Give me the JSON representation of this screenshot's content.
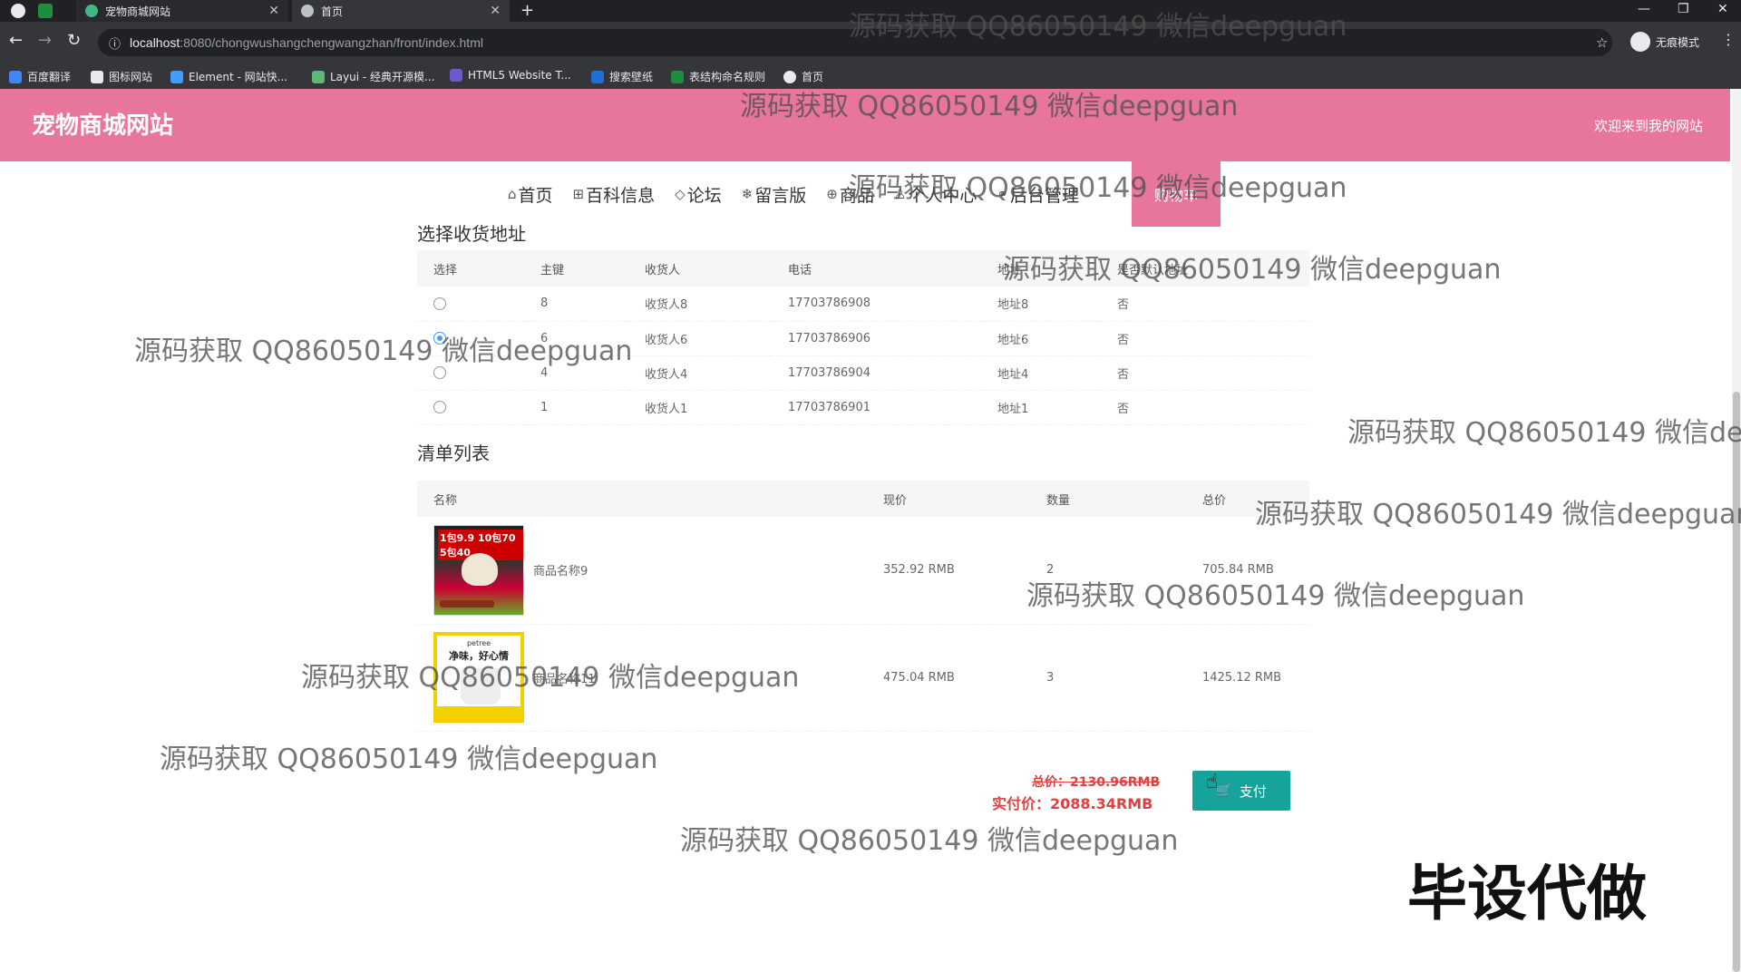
{
  "browser": {
    "tabs": [
      {
        "label": "宠物商城网站"
      },
      {
        "label": "首页"
      }
    ],
    "address": {
      "host": "localhost",
      "path": ":8080/chongwushangchengwangzhan/front/index.html"
    },
    "incognito_label": "无痕模式",
    "bookmarks": [
      "百度翻译",
      "图标网站",
      "Element - 网站快...",
      "Layui - 经典开源模...",
      "HTML5 Website T...",
      "搜索壁纸",
      "表结构命名规则",
      "首页"
    ]
  },
  "site": {
    "title": "宠物商城网站",
    "welcome": "欢迎来到我的网站",
    "accent_color": "#e8769a"
  },
  "nav": {
    "items": [
      {
        "label": "首页",
        "icon": "home-icon"
      },
      {
        "label": "百科信息",
        "icon": "grid-icon"
      },
      {
        "label": "论坛",
        "icon": "tag-icon"
      },
      {
        "label": "留言版",
        "icon": "snowflake-icon"
      },
      {
        "label": "商品",
        "icon": "cart-icon"
      },
      {
        "label": "个人中心",
        "icon": "user-icon"
      },
      {
        "label": "后台管理",
        "icon": "link-icon"
      }
    ],
    "cart_label": "购物车"
  },
  "address_section": {
    "title": "选择收货地址",
    "headers": [
      "选择",
      "主键",
      "收货人",
      "电话",
      "地址",
      "是否默认地址"
    ],
    "rows": [
      {
        "selected": false,
        "id": "8",
        "name": "收货人8",
        "phone": "17703786908",
        "address": "地址8",
        "default": "否"
      },
      {
        "selected": true,
        "id": "6",
        "name": "收货人6",
        "phone": "17703786906",
        "address": "地址6",
        "default": "否"
      },
      {
        "selected": false,
        "id": "4",
        "name": "收货人4",
        "phone": "17703786904",
        "address": "地址4",
        "default": "否"
      },
      {
        "selected": false,
        "id": "1",
        "name": "收货人1",
        "phone": "17703786901",
        "address": "地址1",
        "default": "否"
      }
    ]
  },
  "list_section": {
    "title": "清单列表",
    "headers": [
      "名称",
      "现价",
      "数量",
      "总价"
    ],
    "rows": [
      {
        "name": "商品名称9",
        "price": "352.92 RMB",
        "qty": "2",
        "total": "705.84 RMB",
        "img_tag": "1包9.9 10包70 5包40"
      },
      {
        "name": "商品名称11",
        "price": "475.04 RMB",
        "qty": "3",
        "total": "1425.12 RMB",
        "img_brand": "petree",
        "img_slogan": "净味，好心情"
      }
    ]
  },
  "totals": {
    "original": "总价：2130.96RMB",
    "actual": "实付价：2088.34RMB"
  },
  "pay_button": "支付",
  "watermark": "源码获取 QQ86050149 微信deepguan",
  "corner_text": "毕设代做"
}
